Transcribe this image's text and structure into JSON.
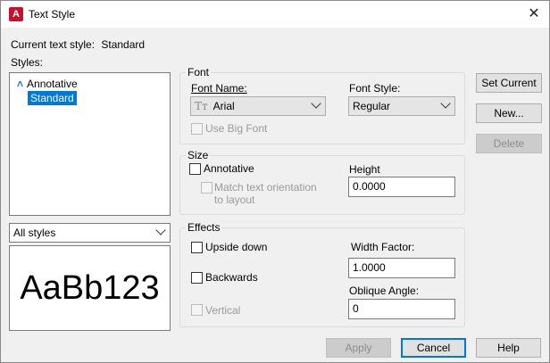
{
  "window": {
    "title": "Text Style",
    "app_icon_letter": "A",
    "close_glyph": "✕"
  },
  "current_style": {
    "label": "Current text style:",
    "value": "Standard"
  },
  "styles": {
    "label": "Styles:",
    "items": [
      {
        "label": "Annotative",
        "icon": "annotative-icon",
        "selected": false
      },
      {
        "label": "Standard",
        "selected": true
      }
    ],
    "filter_value": "All styles"
  },
  "preview": {
    "text": "AaBb123"
  },
  "font": {
    "group_title": "Font",
    "font_name_label": "Font Name:",
    "font_name_value": "Arial",
    "font_name_icon_glyph": "Tᴛ",
    "font_style_label": "Font Style:",
    "font_style_value": "Regular",
    "use_big_font_label": "Use Big Font"
  },
  "size": {
    "group_title": "Size",
    "annotative_label": "Annotative",
    "match_orientation_label_line1": "Match text orientation",
    "match_orientation_label_line2": "to layout",
    "height_label": "Height",
    "height_value": "0.0000"
  },
  "effects": {
    "group_title": "Effects",
    "upside_down_label": "Upside down",
    "backwards_label": "Backwards",
    "vertical_label": "Vertical",
    "width_factor_label": "Width Factor:",
    "width_factor_value": "1.0000",
    "oblique_angle_label": "Oblique Angle:",
    "oblique_angle_value": "0"
  },
  "buttons": {
    "set_current": "Set Current",
    "new": "New...",
    "delete": "Delete",
    "apply": "Apply",
    "cancel": "Cancel",
    "help": "Help"
  },
  "colors": {
    "accent": "#0078d7",
    "app_icon": "#c8102e",
    "annotative_icon": "#1d6fd6"
  }
}
